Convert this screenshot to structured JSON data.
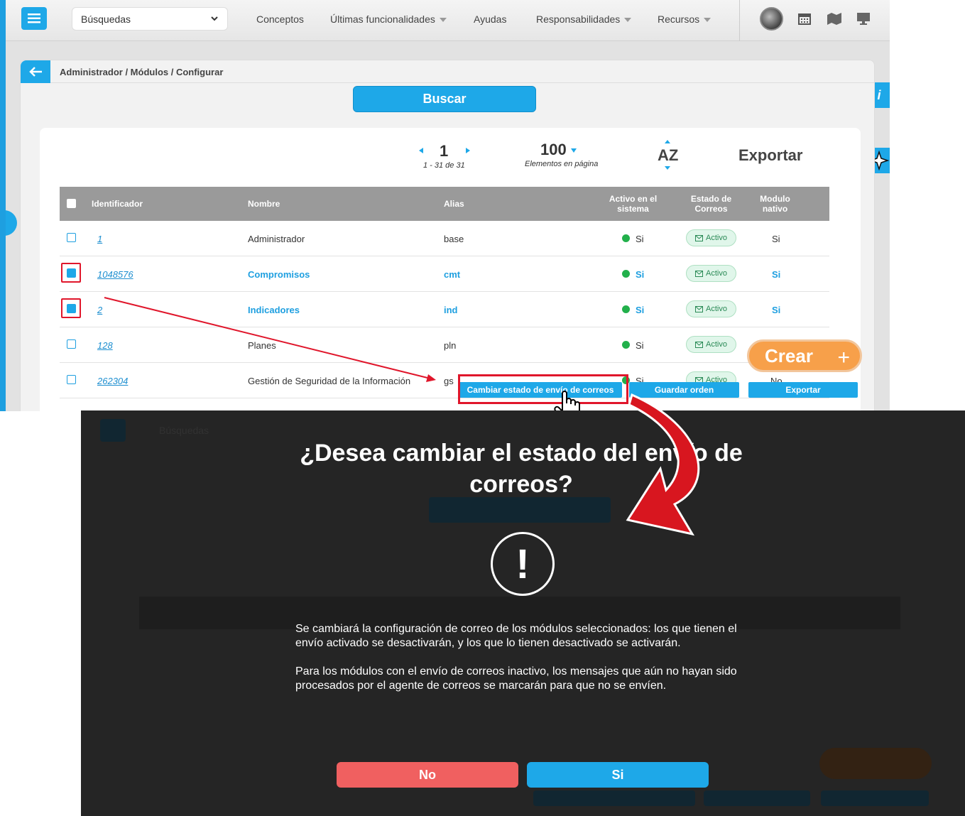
{
  "topbar": {
    "search_select": "Búsquedas",
    "nav": [
      {
        "label": "Conceptos",
        "caret": false
      },
      {
        "label": "Últimas funcionalidades",
        "caret": true
      },
      {
        "label": "Ayudas",
        "caret": false
      },
      {
        "label": "Responsabilidades",
        "caret": true
      },
      {
        "label": "Recursos",
        "caret": true
      }
    ],
    "icons": [
      "calendar-icon",
      "map-icon",
      "monitor-icon"
    ]
  },
  "breadcrumb": "Administrador / Módulos / Configurar",
  "search_button": "Buscar",
  "pager": {
    "page": "1",
    "range": "1 - 31 de 31"
  },
  "per_page": {
    "value": "100",
    "label": "Elementos en página"
  },
  "sort_label": "AZ",
  "export_label": "Exportar",
  "table": {
    "headers": {
      "id": "Identificador",
      "name": "Nombre",
      "alias": "Alias",
      "active_l1": "Activo en el",
      "active_l2": "sistema",
      "mail_l1": "Estado de",
      "mail_l2": "Correos",
      "native_l1": "Modulo",
      "native_l2": "nativo"
    },
    "rows": [
      {
        "id": "1",
        "name": "Administrador",
        "alias": "base",
        "active": "Si",
        "mail": "Activo",
        "native": "Si",
        "checked": false
      },
      {
        "id": "1048576",
        "name": "Compromisos",
        "alias": "cmt",
        "active": "Si",
        "mail": "Activo",
        "native": "Si",
        "checked": true
      },
      {
        "id": "2",
        "name": "Indicadores",
        "alias": "ind",
        "active": "Si",
        "mail": "Activo",
        "native": "Si",
        "checked": true
      },
      {
        "id": "128",
        "name": "Planes",
        "alias": "pln",
        "active": "Si",
        "mail": "Activo",
        "native": "",
        "checked": false
      },
      {
        "id": "262304",
        "name": "Gestión de Seguridad de la Información",
        "alias": "gs",
        "active": "Si",
        "mail": "Activo",
        "native": "No",
        "checked": false
      }
    ]
  },
  "create_button": "Crear",
  "action_bar": {
    "change_mail": "Cambiar estado de envío de correos",
    "save_order": "Guardar orden",
    "export": "Exportar"
  },
  "info_tab": "i",
  "modal": {
    "title": "¿Desea cambiar el estado del envío de correos?",
    "paragraph1": "Se cambiará la configuración de correo de los módulos seleccionados: los que tienen el envío activado se desactivarán, y los que lo tienen desactivado se activarán.",
    "paragraph2": "Para los módulos con el envío de correos inactivo, los mensajes que aún no hayan sido procesados por el agente de correos se marcarán para que no se envíen.",
    "no_label": "No",
    "yes_label": "Si"
  },
  "colors": {
    "accent": "#1ea8e8",
    "create": "#f7a04a",
    "danger": "#f06060",
    "highlight": "#e0162b",
    "active_dot": "#22b04b"
  }
}
